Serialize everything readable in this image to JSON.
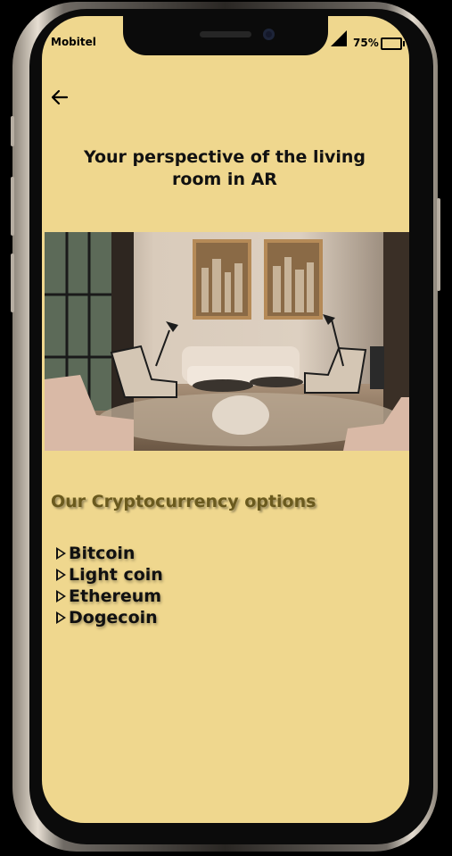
{
  "status_bar": {
    "carrier": "Mobitel",
    "battery": "75%"
  },
  "header": {
    "title": "Your perspective of the living room in AR",
    "back_icon": "arrow-left-icon"
  },
  "image": {
    "subject": "living room",
    "icon": "living-room-photo"
  },
  "crypto": {
    "heading": "Our Cryptocurrency  options",
    "items": [
      "Bitcoin",
      "Light coin",
      "Ethereum",
      "Dogecoin"
    ]
  },
  "colors": {
    "screen_bg": "#efd78e",
    "heading": "#6a5a1e",
    "text": "#111111"
  }
}
